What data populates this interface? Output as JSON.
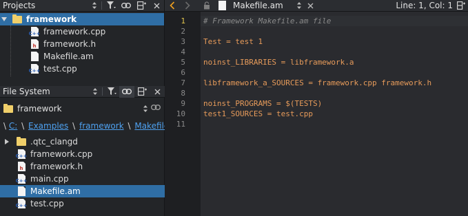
{
  "projects_pane": {
    "title": "Projects",
    "tree": [
      {
        "label": "framework",
        "type": "folder",
        "expanded": true,
        "bold": true,
        "selected": true
      },
      {
        "label": "framework.cpp",
        "type": "cpp"
      },
      {
        "label": "framework.h",
        "type": "h"
      },
      {
        "label": "Makefile.am",
        "type": "file"
      },
      {
        "label": "test.cpp",
        "type": "cpp"
      }
    ]
  },
  "filesystem_pane": {
    "title": "File System",
    "combo_value": "framework",
    "breadcrumb": {
      "root": "\\",
      "parts": [
        "C:",
        "Examples",
        "framework",
        "Makefile.am"
      ]
    },
    "tree": [
      {
        "label": ".qtc_clangd",
        "type": "folder",
        "collapsed": true
      },
      {
        "label": "framework.cpp",
        "type": "cpp"
      },
      {
        "label": "framework.h",
        "type": "h"
      },
      {
        "label": "main.cpp",
        "type": "cpp"
      },
      {
        "label": "Makefile.am",
        "type": "file",
        "selected": true
      },
      {
        "label": "test.cpp",
        "type": "cpp"
      }
    ]
  },
  "editor": {
    "tab_name": "Makefile.am",
    "position": "Line: 1, Col: 1",
    "current_line": 1,
    "line_numbers": [
      "1",
      "2",
      "3",
      "4",
      "5",
      "6",
      "7",
      "8",
      "9",
      "10",
      "11"
    ],
    "lines": [
      {
        "text": "# Framework Makefile.am file",
        "kind": "comment"
      },
      {
        "text": "",
        "kind": "code"
      },
      {
        "text": "Test = test 1",
        "kind": "code"
      },
      {
        "text": "",
        "kind": "code"
      },
      {
        "text": "noinst_LIBRARIES = libframework.a",
        "kind": "code"
      },
      {
        "text": "",
        "kind": "code"
      },
      {
        "text": "libframework_a_SOURCES = framework.cpp framework.h",
        "kind": "code"
      },
      {
        "text": "",
        "kind": "code"
      },
      {
        "text": "noinst_PROGRAMS = $(TESTS)",
        "kind": "code"
      },
      {
        "text": "test1_SOURCES = test.cpp",
        "kind": "code"
      },
      {
        "text": "",
        "kind": "code"
      }
    ]
  },
  "colors": {
    "accent_selection": "#2f6ea5",
    "code_text": "#e79b5a",
    "comment": "#8a8a8a",
    "current_line_number": "#e6c84e",
    "back_arrow": "#f0a020",
    "link": "#4ea1f0"
  }
}
